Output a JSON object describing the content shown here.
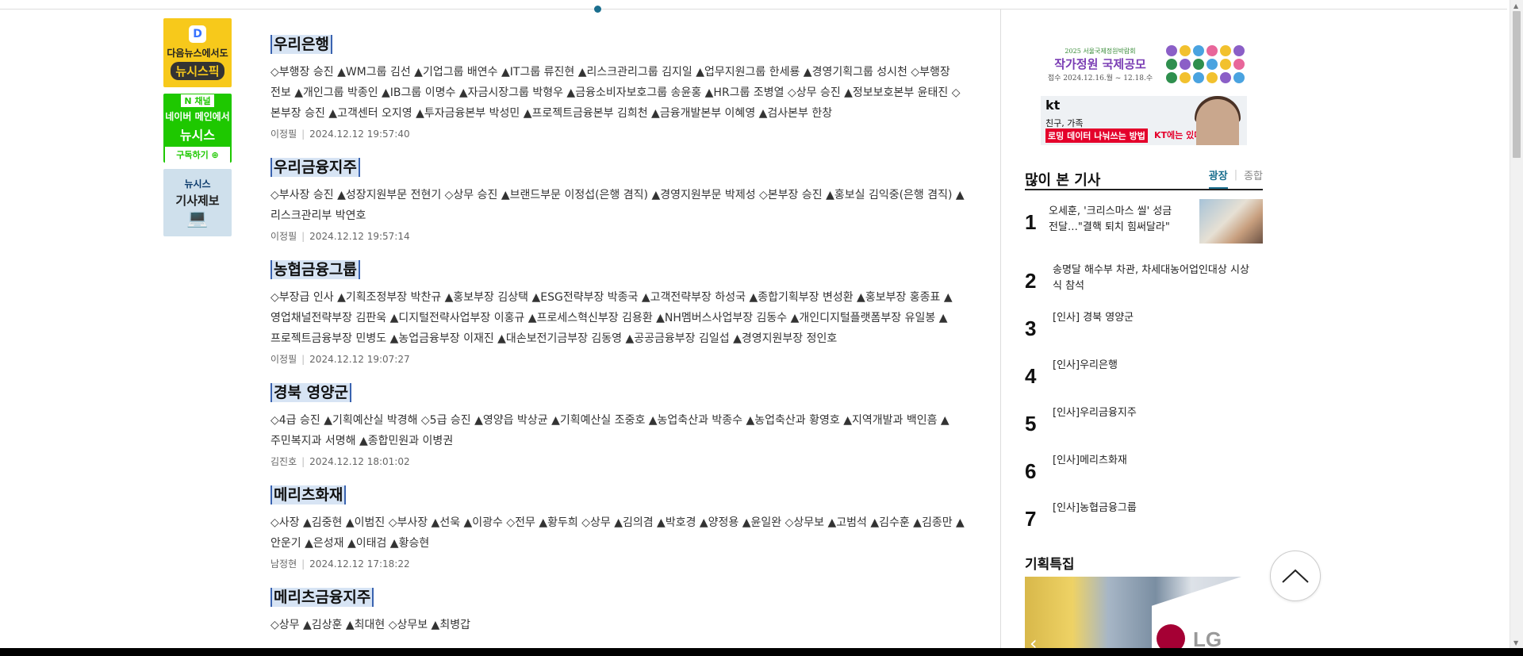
{
  "left_banners": {
    "daum": {
      "logo": "D",
      "line1": "다음뉴스에서도",
      "line2": "뉴시스픽"
    },
    "naver": {
      "badge": "N 채널",
      "line1": "네이버 메인에서",
      "line2": "뉴시스",
      "subscribe": "구독하기 ⊕"
    },
    "tip": {
      "line1": "뉴시스",
      "line2": "기사제보"
    }
  },
  "articles": [
    {
      "title": "우리은행",
      "body": "◇부행장 승진 ▲WM그룹 김선 ▲기업그룹 배연수 ▲IT그룹 류진현 ▲리스크관리그룹 김지일 ▲업무지원그룹 한세룡 ▲경영기획그룹 성시천 ◇부행장 전보 ▲개인그룹 박종인 ▲IB그룹 이명수 ▲자금시장그룹 박형우 ▲금융소비자보호그룹 송윤홍 ▲HR그룹 조병열 ◇상무 승진 ▲정보보호본부 윤태진 ◇본부장 승진 ▲고객센터 오지영 ▲투자금융본부 박성민 ▲프로젝트금융본부 김희천 ▲금융개발본부 이혜영 ▲검사본부 한창",
      "author": "이정필",
      "datetime": "2024.12.12 19:57:40"
    },
    {
      "title": "우리금융지주",
      "body": "◇부사장 승진 ▲성장지원부문 전현기 ◇상무 승진 ▲브랜드부문 이정섭(은행 겸직) ▲경영지원부문 박제성 ◇본부장 승진 ▲홍보실 김익중(은행 겸직) ▲리스크관리부 박연호",
      "author": "이정필",
      "datetime": "2024.12.12 19:57:14"
    },
    {
      "title": "농협금융그룹",
      "body": "◇부장급 인사 ▲기획조정부장 박찬규 ▲홍보부장 김상택 ▲ESG전략부장 박종국 ▲고객전략부장 하성국 ▲종합기획부장 변성환 ▲홍보부장 홍종표 ▲영업채널전략부장 김판욱 ▲디지털전략사업부장 이홍규 ▲프로세스혁신부장 김용환 ▲NH멤버스사업부장 김동수 ▲개인디지털플랫폼부장 유일봉 ▲프로젝트금융부장 민병도 ▲농업금융부장 이재진 ▲대손보전기금부장 김동영 ▲공공금융부장 김일섭 ▲경영지원부장 정인호",
      "author": "이정필",
      "datetime": "2024.12.12 19:07:27"
    },
    {
      "title": "경북 영양군",
      "body": "◇4급 승진 ▲기획예산실 박경해 ◇5급 승진 ▲영양읍 박상균 ▲기획예산실 조중호 ▲농업축산과 박종수 ▲농업축산과 황영호 ▲지역개발과 백인흠 ▲주민복지과 서명해 ▲종합민원과 이병권",
      "author": "김진호",
      "datetime": "2024.12.12 18:01:02"
    },
    {
      "title": "메리츠화재",
      "body": "◇사장 ▲김중현 ▲이범진 ◇부사장 ▲선욱 ▲이광수 ◇전무 ▲황두희 ◇상무 ▲김의겸 ▲박호경 ▲양정용 ▲윤일완 ◇상무보 ▲고범석 ▲김수훈 ▲김종만 ▲안운기 ▲은성재 ▲이태검 ▲황승현",
      "author": "남정현",
      "datetime": "2024.12.12 17:18:22"
    },
    {
      "title": "메리츠금융지주",
      "body": "◇상무 ▲김상훈 ▲최대현 ◇상무보 ▲최병갑",
      "author": "",
      "datetime": ""
    }
  ],
  "ads": {
    "contest": {
      "small": "2025 서울국제정원박람회",
      "title": "작가정원 국제공모",
      "date": "접수 2024.12.16.월 ~ 12.18.수"
    },
    "kt": {
      "brand": "kt",
      "line1": "친구, 가족",
      "line2": "로밍 데이터 나눠쓰는 방법",
      "line3": "KT에는 있다"
    }
  },
  "popular": {
    "title": "많이 본 기사",
    "tabs": [
      "광장",
      "종합"
    ],
    "items": [
      {
        "rank": "1",
        "title": "오세훈, '크리스마스 씰' 성금 전달…\"결핵 퇴치 힘써달라\""
      },
      {
        "rank": "2",
        "title": "송명달 해수부 차관, 차세대농어업인대상 시상식 참석"
      },
      {
        "rank": "3",
        "title": "[인사] 경북 영양군"
      },
      {
        "rank": "4",
        "title": "[인사]우리은행"
      },
      {
        "rank": "5",
        "title": "[인사]우리금융지주"
      },
      {
        "rank": "6",
        "title": "[인사]메리츠화재"
      },
      {
        "rank": "7",
        "title": "[인사]농협금융그룹"
      }
    ]
  },
  "special": {
    "title": "기획특집",
    "image_text": "LG"
  },
  "colors": {
    "accent": "#1a6e8e",
    "title_highlight": "#d7e4f4",
    "naver_green": "#1ec800",
    "daum_yellow": "#f7c91b"
  }
}
